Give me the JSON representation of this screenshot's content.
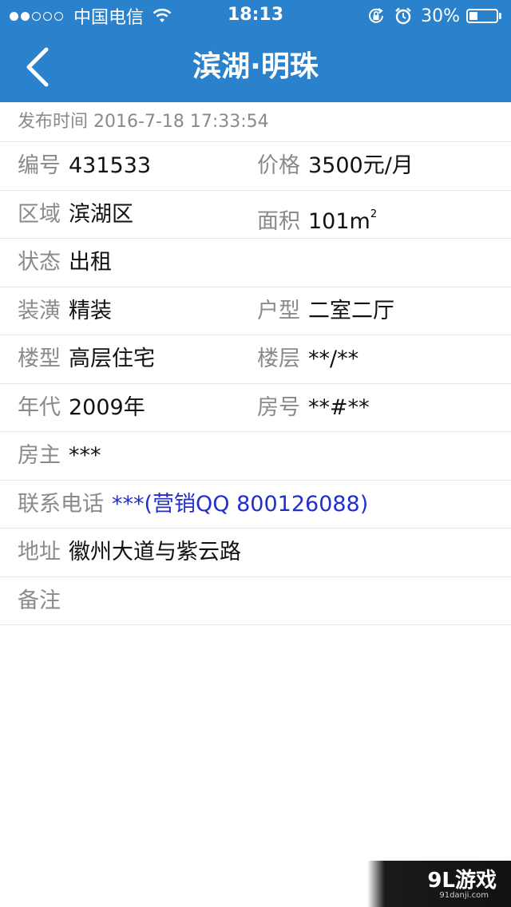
{
  "status_bar": {
    "carrier": "中国电信",
    "time": "18:13",
    "battery_text": "30%",
    "battery_level": 0.3,
    "signal_bars_filled": 2,
    "signal_bars_total": 5
  },
  "nav": {
    "title": "滨湖·明珠",
    "back_icon": "chevron-left-icon"
  },
  "publish": {
    "label": "发布时间",
    "value": "2016-7-18 17:33:54"
  },
  "details": {
    "number": {
      "label": "编号",
      "value": "431533"
    },
    "price": {
      "label": "价格",
      "value": "3500元/月"
    },
    "district": {
      "label": "区域",
      "value": "滨湖区"
    },
    "area": {
      "label": "面积",
      "value": "101m",
      "unit_sup": "2"
    },
    "status": {
      "label": "状态",
      "value": "出租"
    },
    "decoration": {
      "label": "装潢",
      "value": "精装"
    },
    "layout": {
      "label": "户型",
      "value": "二室二厅"
    },
    "building_type": {
      "label": "楼型",
      "value": "高层住宅"
    },
    "floor": {
      "label": "楼层",
      "value": "**/**"
    },
    "year": {
      "label": "年代",
      "value": "2009年"
    },
    "room_no": {
      "label": "房号",
      "value": "**#**"
    },
    "owner": {
      "label": "房主",
      "value": "***"
    },
    "phone": {
      "label": "联系电话",
      "value": "***(营销QQ 800126088)"
    },
    "address": {
      "label": "地址",
      "value": "徽州大道与紫云路"
    },
    "remark": {
      "label": "备注",
      "value": ""
    }
  },
  "watermark": {
    "logo": "9L游戏",
    "url": "91danji.com"
  },
  "colors": {
    "nav_bg": "#2a82cc",
    "label": "#8a8a8a",
    "value": "#111111",
    "link": "#2330c8"
  }
}
